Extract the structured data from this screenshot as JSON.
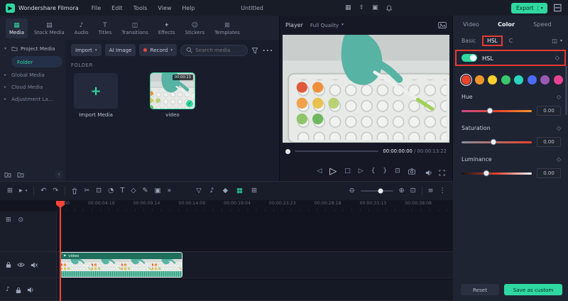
{
  "colors": {
    "accent": "#2fd8a0",
    "annotation": "#e23b32"
  },
  "menubar": {
    "app_name": "Wondershare Filmora",
    "menus": [
      "File",
      "Edit",
      "Tools",
      "View",
      "Help"
    ],
    "project_title": "Untitled",
    "export_label": "Export"
  },
  "media_tabs": [
    "Media",
    "Stock Media",
    "Audio",
    "Titles",
    "Transitions",
    "Effects",
    "Stickers",
    "Templates"
  ],
  "sidebar": {
    "project_media": "Project Media",
    "folder": "Folder",
    "items": [
      "Global Media",
      "Cloud Media",
      "Adjustment La..."
    ]
  },
  "media_toolbar": {
    "import_label": "Import",
    "ai_image_label": "AI Image",
    "record_label": "Record",
    "search_placeholder": "Search media"
  },
  "folder_panel": {
    "title": "FOLDER",
    "import_tile_label": "Import Media",
    "clip_name": "video",
    "clip_duration": "00:00:13"
  },
  "player": {
    "label": "Player",
    "quality": "Full Quality",
    "current_time": "00:00:00:00",
    "separator": "/",
    "duration": "00:00:13:22"
  },
  "properties": {
    "tabs": [
      "Video",
      "Color",
      "Speed"
    ],
    "subtabs": {
      "basic": "Basic",
      "hsl": "HSL",
      "curves": "C"
    },
    "hsl_toggle_label": "HSL",
    "swatches": [
      "#e8432e",
      "#f2952c",
      "#f5cf2e",
      "#39c96a",
      "#2bd4c0",
      "#4a6cf7",
      "#9b59b6",
      "#e84393"
    ],
    "sliders": [
      {
        "label": "Hue",
        "value": "0.00"
      },
      {
        "label": "Saturation",
        "value": "0.00"
      },
      {
        "label": "Luminance",
        "value": "0.00"
      }
    ],
    "reset_label": "Reset",
    "save_label": "Save as custom"
  },
  "timeline": {
    "ruler": [
      "00:00",
      "00:00:04:19",
      "00:00:09:14",
      "00:00:14:09",
      "00:00:19:04",
      "00:00:23:23",
      "00:00:28:18",
      "00:00:33:13",
      "00:00:38:08"
    ],
    "clip_label": "video"
  }
}
